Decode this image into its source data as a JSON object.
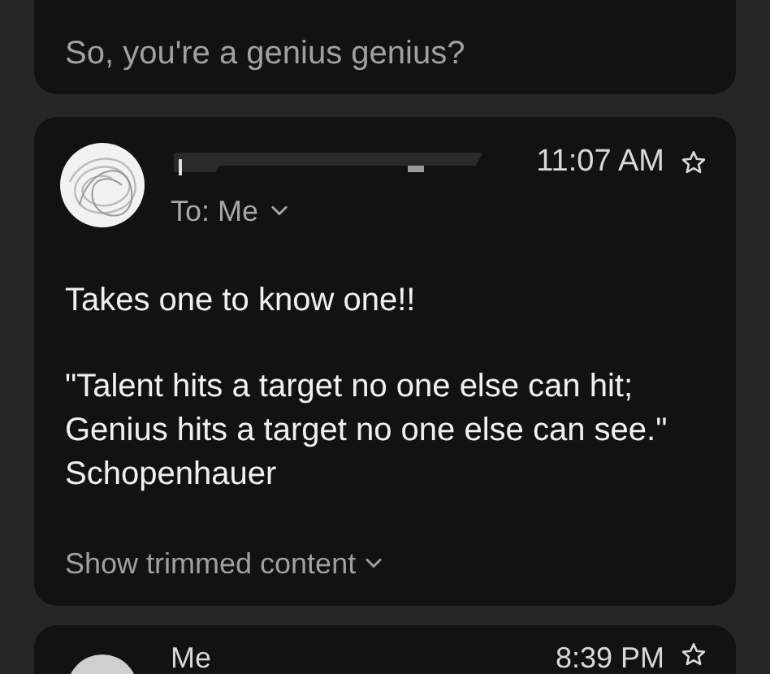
{
  "messages": [
    {
      "kind": "snippet",
      "snippet": "So, you're a genius genius?"
    },
    {
      "kind": "expanded",
      "time": "11:07 AM",
      "starred": false,
      "recipient": "To: Me",
      "paragraphs": [
        "Takes one to know one!!",
        "\"Talent hits a target no one else can hit; Genius hits a target no one else can see.\" Schopenhauer"
      ],
      "trimmed_link": "Show trimmed content"
    },
    {
      "kind": "collapsed",
      "sender": "Me",
      "time": "8:39 PM",
      "starred": false
    }
  ]
}
